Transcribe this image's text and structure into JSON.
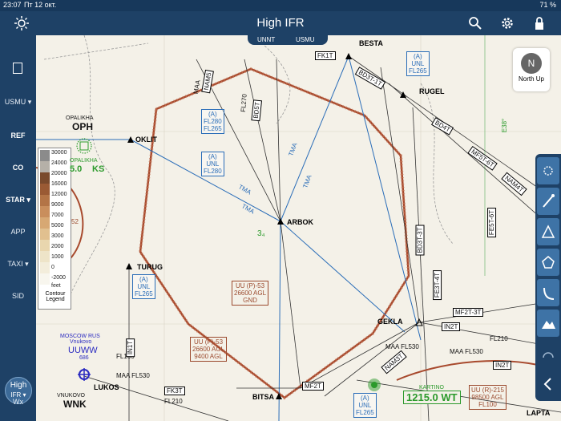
{
  "status_bar": {
    "time": "23:07",
    "date": "Пт 12 окт.",
    "battery": "71 %"
  },
  "header": {
    "title": "High IFR"
  },
  "sidebar": {
    "items": [
      {
        "label": "USMU ▾"
      },
      {
        "label": "REF"
      },
      {
        "label": "CO"
      },
      {
        "label": "STAR ▾"
      },
      {
        "label": "APP"
      },
      {
        "label": "TAXI ▾"
      },
      {
        "label": "SID"
      },
      {
        "label": "Wx"
      }
    ],
    "layer_button": {
      "line1": "High",
      "line2": "IFR ▾"
    }
  },
  "map": {
    "tab": {
      "left": "UNNT",
      "right": "USMU"
    },
    "north_up": {
      "letter": "N",
      "label": "North Up"
    },
    "legend": {
      "title": "Contour Legend",
      "unit": "feet",
      "values": [
        "30000",
        "24000",
        "20000",
        "16000",
        "12000",
        "9000",
        "7000",
        "5000",
        "3000",
        "2000",
        "1000",
        "0",
        "-2000"
      ]
    },
    "fixes": [
      "OKLIT",
      "ARBOK",
      "TURUG",
      "BITSA",
      "LUKOS",
      "GEKLA",
      "BESTA",
      "RUGEL",
      "LAPTA"
    ],
    "airports": {
      "oph_name": "OPALIKHA",
      "oph_code": "OPH",
      "oph_name2": "OPALIKHA",
      "vnukovo_city": "MOSCOW RUS",
      "vnukovo_name": "Vnukovo",
      "vnukovo_icao": "UUWW",
      "vnukovo_elev": "686",
      "vnukovo_vor": "VNUKOVO",
      "vnukovo_code": "WNK"
    },
    "frequencies": {
      "oph": "5.0",
      "oph_suffix": "KS",
      "kartino": "1215.0",
      "kartino_suffix": "WT",
      "kartino_name": "KARTINO"
    },
    "airspace_boxes": [
      {
        "l1": "(A)",
        "l2": "UNL",
        "l3": "FL265"
      },
      {
        "l1": "(A)",
        "l2": "FL280",
        "l3": "FL265"
      },
      {
        "l1": "(A)",
        "l2": "UNL",
        "l3": "FL280"
      },
      {
        "l1": "(A)",
        "l2": "UNL",
        "l3": "FL265"
      },
      {
        "l1": "(A)",
        "l2": "UNL",
        "l3": "FL265"
      }
    ],
    "restricted_boxes": [
      {
        "l1": "UU (P)-53",
        "l2": "26600 AGL",
        "l3": "GND"
      },
      {
        "l1": "UU (P)-53",
        "l2": "26600 AGL",
        "l3": "9400 AGL"
      },
      {
        "l1": "UU (R)-215",
        "l2": "98500 AGL",
        "l3": "FL100"
      }
    ],
    "labels": {
      "tma": "TMA",
      "tma_a": "(A)",
      "maa530": "MAA FL530",
      "fl210": "FL210",
      "fl160": "FL160",
      "maa": "MAA",
      "fl270": "FL270",
      "e38": "E38°",
      "num34": "3₄",
      "num52": "52"
    },
    "airways": [
      "NAM5",
      "BD5T",
      "FK1T",
      "FK3T",
      "MF2T",
      "NAM3T",
      "BD3T-3T",
      "IN2T",
      "MF2T-3T",
      "FE3T-4T",
      "BD4T",
      "MF5T-6T",
      "FE5T-6T",
      "NAM4T",
      "BD3T-1T",
      "IN1T",
      "IN2T"
    ]
  }
}
